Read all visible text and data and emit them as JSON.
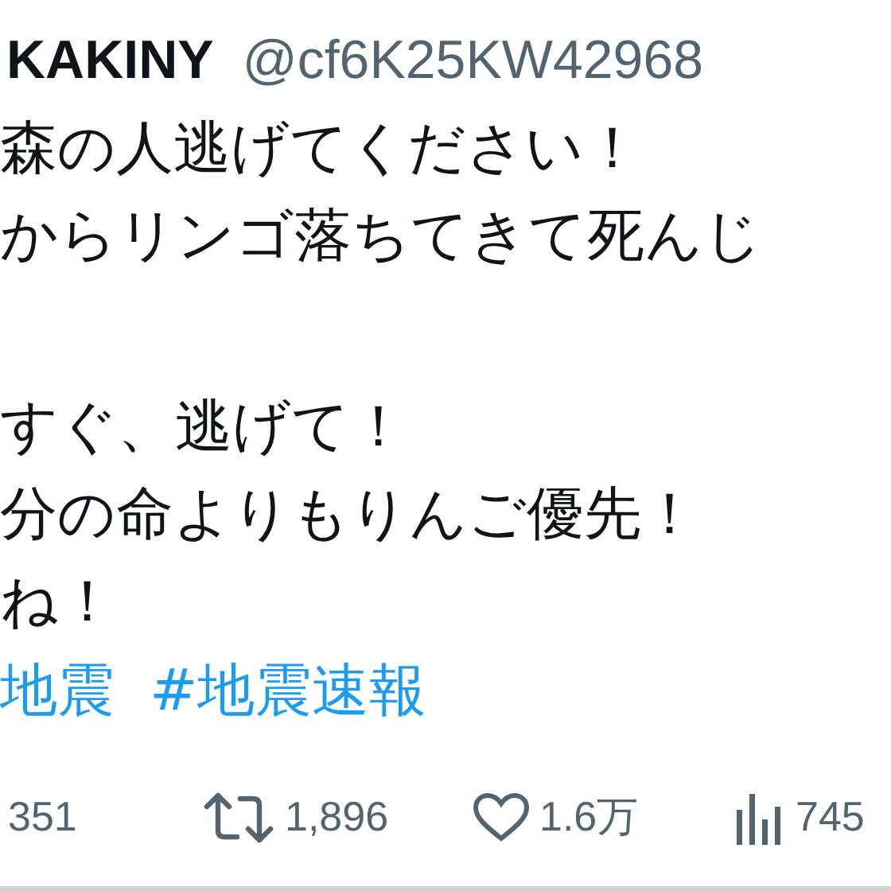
{
  "author": {
    "name": "KAKINY",
    "handle": "@cf6K25KW42968"
  },
  "paragraphs": [
    [
      "森の人逃げてください！",
      "からリンゴ落ちてきて死んじ"
    ],
    [
      "すぐ、逃げて！",
      "分の命よりもりんご優先！",
      "ね！"
    ]
  ],
  "hashtags": [
    "地震",
    "#地震速報"
  ],
  "stats": [
    {
      "kind": "reply",
      "count": "351"
    },
    {
      "kind": "retweet",
      "count": "1,896"
    },
    {
      "kind": "like",
      "count": "1.6万"
    },
    {
      "kind": "views",
      "count": "745"
    }
  ]
}
